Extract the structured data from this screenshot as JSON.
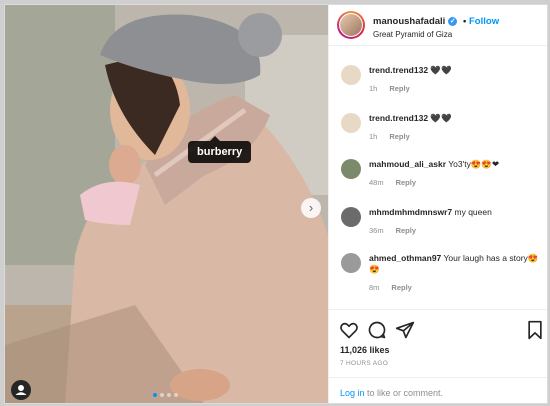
{
  "media": {
    "tag_label": "burberry",
    "next_glyph": "›",
    "carousel_total": 4,
    "carousel_active": 1
  },
  "post": {
    "username": "manoushafadali",
    "verified_glyph": "✓",
    "separator": "•",
    "follow_label": "Follow",
    "location": "Great Pyramid of Giza"
  },
  "comments": [
    {
      "user": "trend.trend132",
      "text": "🖤🖤",
      "age": "1h",
      "reply": "Reply",
      "avatar_color": "#e7d9c6"
    },
    {
      "user": "trend.trend132",
      "text": "🖤🖤",
      "age": "1h",
      "reply": "Reply",
      "avatar_color": "#e7d9c6"
    },
    {
      "user": "mahmoud_ali_askr",
      "text": "Yo3'ty😍😍❤",
      "age": "48m",
      "reply": "Reply",
      "avatar_color": "#7a8a6a"
    },
    {
      "user": "mhmdmhmdmnswr7",
      "text": "my queen",
      "age": "36m",
      "reply": "Reply",
      "avatar_color": "#6b6b6b"
    },
    {
      "user": "ahmed_othman97",
      "text": "Your laugh has a story😍😍",
      "age": "8m",
      "reply": "Reply",
      "avatar_color": "#9a9a9a"
    }
  ],
  "footer": {
    "likes": "11,026 likes",
    "time": "7 HOURS AGO",
    "login_link": "Log in",
    "login_text": " to like or comment."
  },
  "icons": [
    "heart-icon",
    "comment-icon",
    "share-icon",
    "bookmark-icon",
    "user-tag-icon",
    "chevron-right-icon",
    "verified-icon"
  ]
}
